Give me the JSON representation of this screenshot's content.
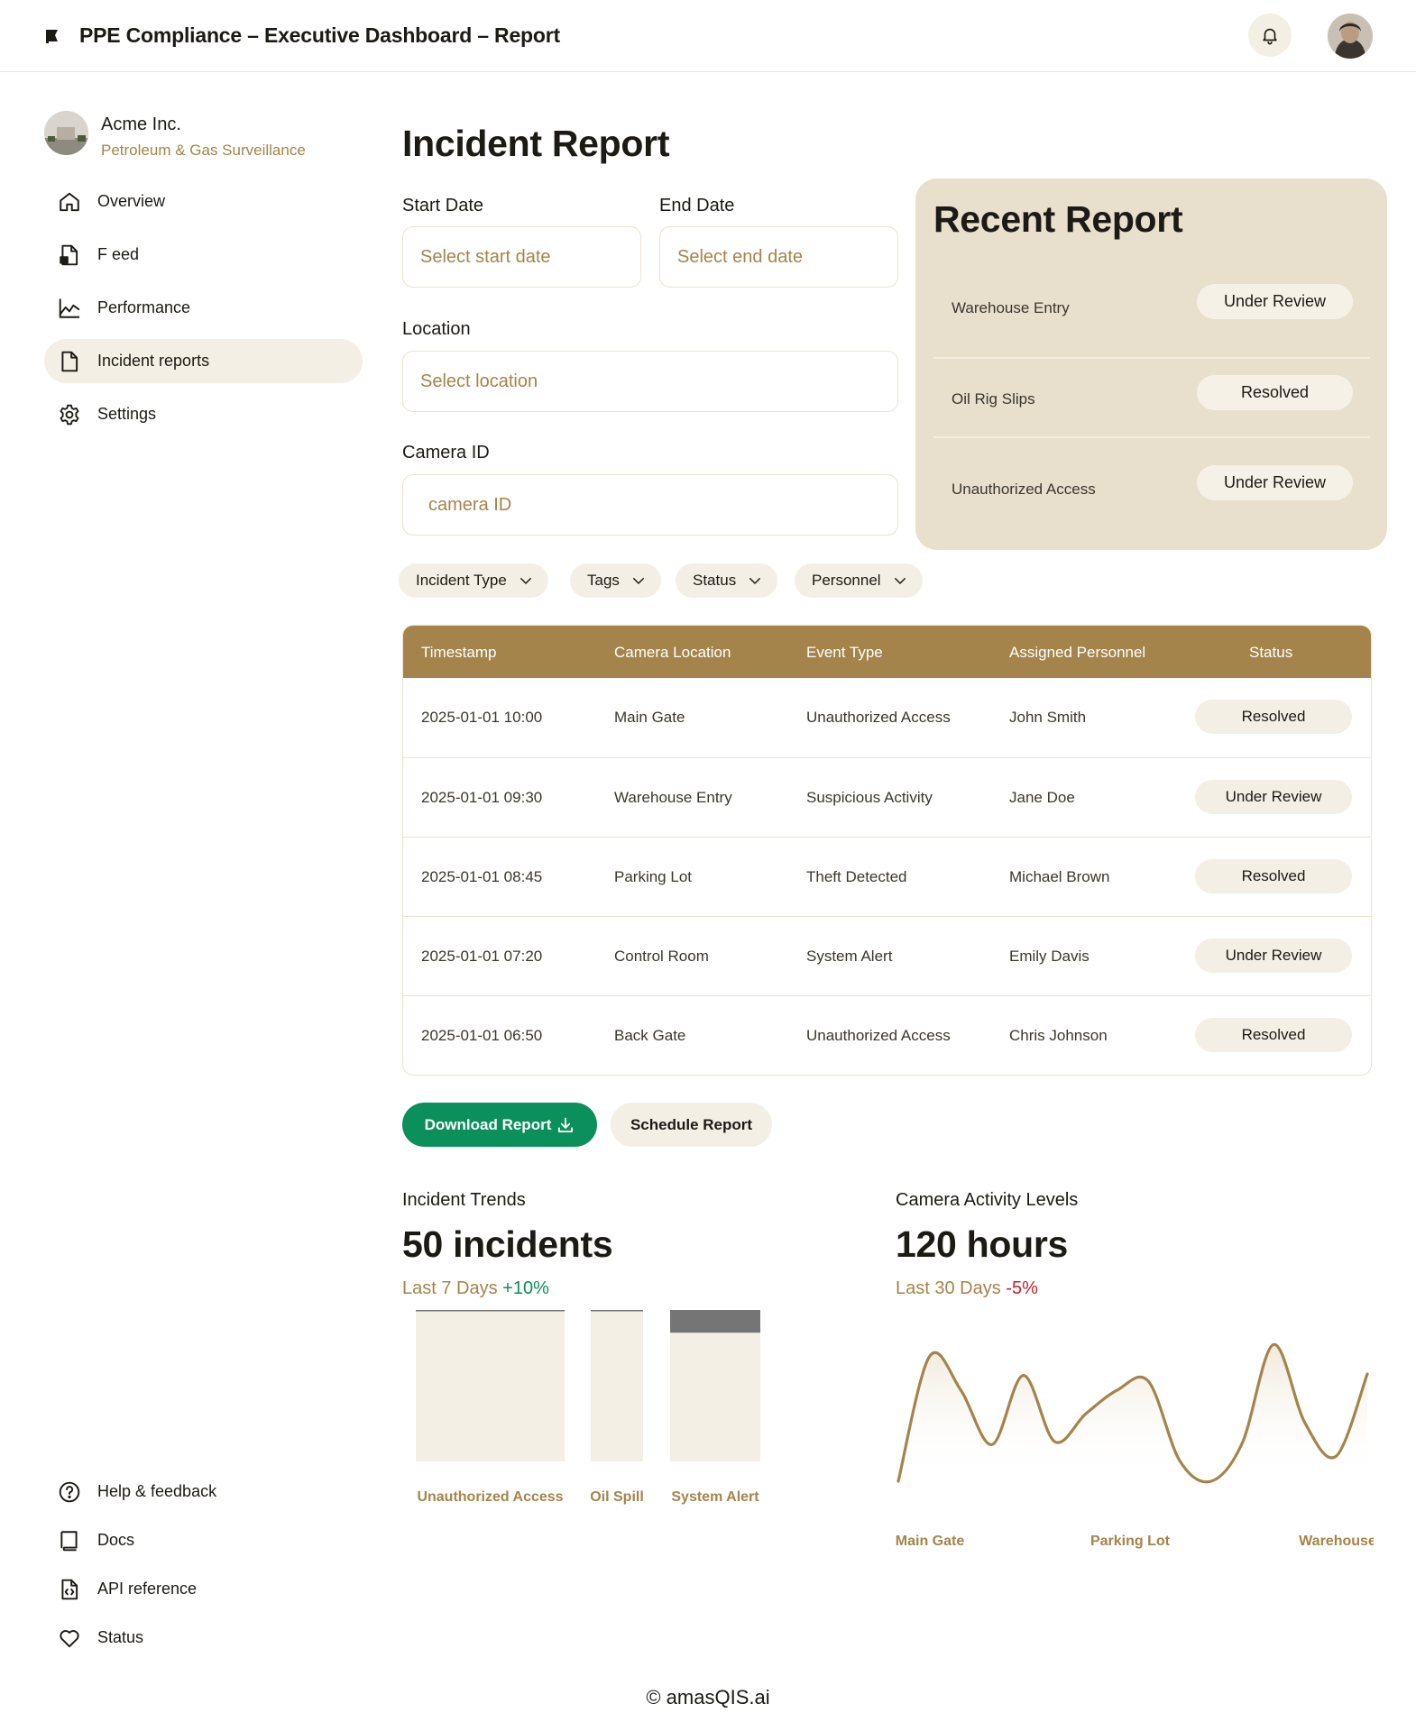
{
  "header": {
    "title": "PPE Compliance – Executive Dashboard –  Report"
  },
  "sidebar": {
    "org_name": "Acme Inc.",
    "org_subtitle": "Petroleum & Gas Surveillance",
    "items": [
      {
        "label": "Overview",
        "icon": "home-icon"
      },
      {
        "label": "F eed",
        "icon": "feed-icon"
      },
      {
        "label": "Performance",
        "icon": "chart-line-icon"
      },
      {
        "label": "Incident reports",
        "icon": "document-icon",
        "active": true
      },
      {
        "label": "Settings",
        "icon": "gear-icon"
      }
    ],
    "bottom_items": [
      {
        "label": "Help & feedback",
        "icon": "help-icon"
      },
      {
        "label": "Docs",
        "icon": "book-icon"
      },
      {
        "label": "API reference",
        "icon": "code-file-icon"
      },
      {
        "label": "Status",
        "icon": "heart-icon"
      }
    ]
  },
  "main": {
    "title": "Incident Report",
    "start_date": {
      "label": "Start Date",
      "placeholder": "Select start date"
    },
    "end_date": {
      "label": "End Date",
      "placeholder": "Select end date"
    },
    "location": {
      "label": "Location",
      "placeholder": "Select location"
    },
    "camera": {
      "label": "Camera ID",
      "placeholder": "camera ID"
    },
    "filters": [
      "Incident Type",
      "Tags",
      "Status",
      "Personnel"
    ]
  },
  "recent": {
    "title": "Recent Report",
    "items": [
      {
        "name": "Warehouse Entry",
        "status": "Under Review"
      },
      {
        "name": "Oil Rig Slips",
        "status": "Resolved"
      },
      {
        "name": "Unauthorized Access",
        "status": "Under Review"
      }
    ]
  },
  "table": {
    "headers": [
      "Timestamp",
      "Camera Location",
      "Event Type",
      "Assigned Personnel",
      "Status"
    ],
    "rows": [
      {
        "timestamp": "2025-01-01 10:00",
        "location": "Main Gate",
        "event": "Unauthorized Access",
        "personnel": "John Smith",
        "status": "Resolved"
      },
      {
        "timestamp": "2025-01-01 09:30",
        "location": "Warehouse Entry",
        "event": "Suspicious Activity",
        "personnel": "Jane Doe",
        "status": "Under Review"
      },
      {
        "timestamp": "2025-01-01 08:45",
        "location": "Parking Lot",
        "event": "Theft Detected",
        "personnel": "Michael Brown",
        "status": "Resolved"
      },
      {
        "timestamp": "2025-01-01 07:20",
        "location": "Control Room",
        "event": "System Alert",
        "personnel": "Emily Davis",
        "status": "Under Review"
      },
      {
        "timestamp": "2025-01-01 06:50",
        "location": "Back Gate",
        "event": "Unauthorized Access",
        "personnel": "Chris Johnson",
        "status": "Resolved"
      }
    ]
  },
  "actions": {
    "download": "Download Report",
    "schedule": "Schedule Report"
  },
  "trends": {
    "label": "Incident Trends",
    "value": "50 incidents",
    "period": "Last 7 Days",
    "change": "+10%"
  },
  "activity": {
    "label": "Camera Activity Levels",
    "value": "120 hours",
    "period": "Last 30 Days",
    "change": "-5%"
  },
  "chart_data": [
    {
      "type": "bar",
      "title": "Incident Trends",
      "categories": [
        "Unauthorized Access",
        "Oil Spill",
        "System Alert"
      ],
      "values": [
        1.0,
        1.0,
        0.85
      ],
      "ylim": [
        0,
        1
      ],
      "bar_color": "#f3efe5",
      "top_color": "#757575"
    },
    {
      "type": "line",
      "title": "Camera Activity Levels",
      "x_labels": [
        "Main Gate",
        "Parking Lot",
        "Warehouse"
      ],
      "values": [
        0.0,
        0.85,
        0.62,
        0.25,
        0.72,
        0.27,
        0.46,
        0.62,
        0.68,
        0.14,
        0.0,
        0.26,
        0.93,
        0.4,
        0.17,
        0.73
      ],
      "ylim": [
        0,
        1
      ],
      "line_color": "#a4844a"
    }
  ],
  "footer": "© amasQIS.ai"
}
